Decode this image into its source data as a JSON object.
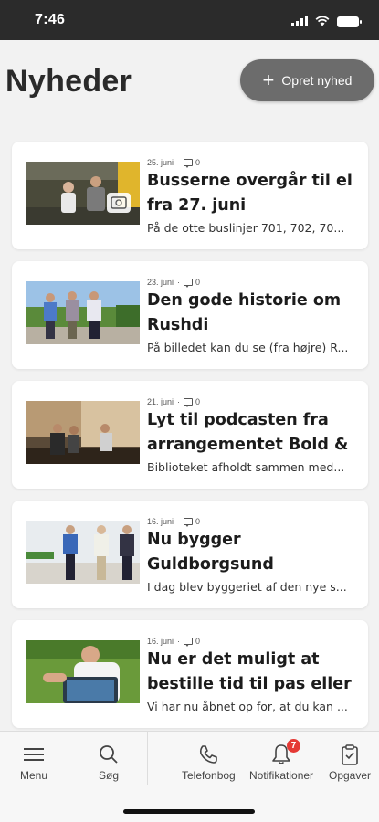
{
  "status_bar": {
    "time": "7:46"
  },
  "header": {
    "title": "Nyheder",
    "create_label": "Opret nyhed"
  },
  "news": [
    {
      "date": "25. juni",
      "comments": "0",
      "title": "Busserne overgår til el fra 27. juni",
      "excerpt": "På de otte buslinjer 701, 702, 70..."
    },
    {
      "date": "23. juni",
      "comments": "0",
      "title": "Den gode historie om Rushdi",
      "excerpt": "På billedet kan du se (fra højre) R..."
    },
    {
      "date": "21. juni",
      "comments": "0",
      "title": "Lyt til podcasten fra arrangementet Bold & ...",
      "excerpt": "Biblioteket afholdt sammen med..."
    },
    {
      "date": "16. juni",
      "comments": "0",
      "title": "Nu bygger Guldborgsund Kommune Danmarks f...",
      "excerpt": "I dag blev byggeriet af den nye s..."
    },
    {
      "date": "16. juni",
      "comments": "0",
      "title": "Nu er det muligt at bestille tid til pas eller ...",
      "excerpt": "Vi har nu åbnet op for, at du kan ..."
    }
  ],
  "tabbar": {
    "menu": "Menu",
    "search": "Søg",
    "phonebook": "Telefonbog",
    "notifications": "Notifikationer",
    "notifications_badge": "7",
    "tasks": "Opgaver"
  },
  "colors": {
    "accent_button": "#6c6c6c",
    "badge": "#e53935",
    "status_bar": "#2b2b2b"
  }
}
